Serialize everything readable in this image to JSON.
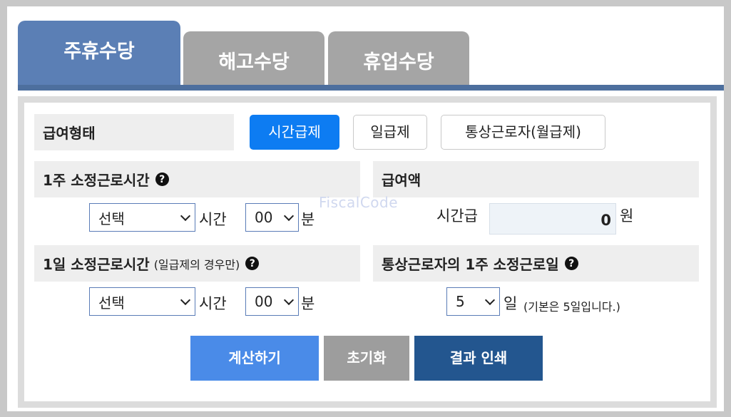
{
  "tabs": [
    {
      "label": "주휴수당",
      "active": true
    },
    {
      "label": "해고수당",
      "active": false
    },
    {
      "label": "휴업수당",
      "active": false
    }
  ],
  "pay_type": {
    "label": "급여형태",
    "options": [
      "시간급제",
      "일급제",
      "통상근로자(월급제)"
    ],
    "selected": "시간급제"
  },
  "weekly_hours": {
    "label": "1주 소정근로시간",
    "help": "?",
    "hour_value": "선택",
    "hour_unit": "시간",
    "minute_value": "00",
    "minute_unit": "분"
  },
  "daily_hours": {
    "label": "1일 소정근로시간",
    "note": "(일급제의 경우만)",
    "help": "?",
    "hour_value": "선택",
    "hour_unit": "시간",
    "minute_value": "00",
    "minute_unit": "분"
  },
  "wage": {
    "label": "급여액",
    "field_label": "시간급",
    "value": "0",
    "unit": "원"
  },
  "work_days": {
    "label": "통상근로자의 1주 소정근로일",
    "help": "?",
    "value": "5",
    "unit": "일",
    "note": "(기본은 5일입니다.)"
  },
  "watermark": "FiscalCode",
  "buttons": {
    "calculate": "계산하기",
    "reset": "초기화",
    "print": "결과 인쇄"
  },
  "colors": {
    "active_tab": "#5b7fb5",
    "inactive_tab": "#a5a5a5",
    "selected_pill": "#0d7cf2",
    "calculate": "#4a8be8",
    "reset": "#9d9d9d",
    "print": "#23568f"
  }
}
